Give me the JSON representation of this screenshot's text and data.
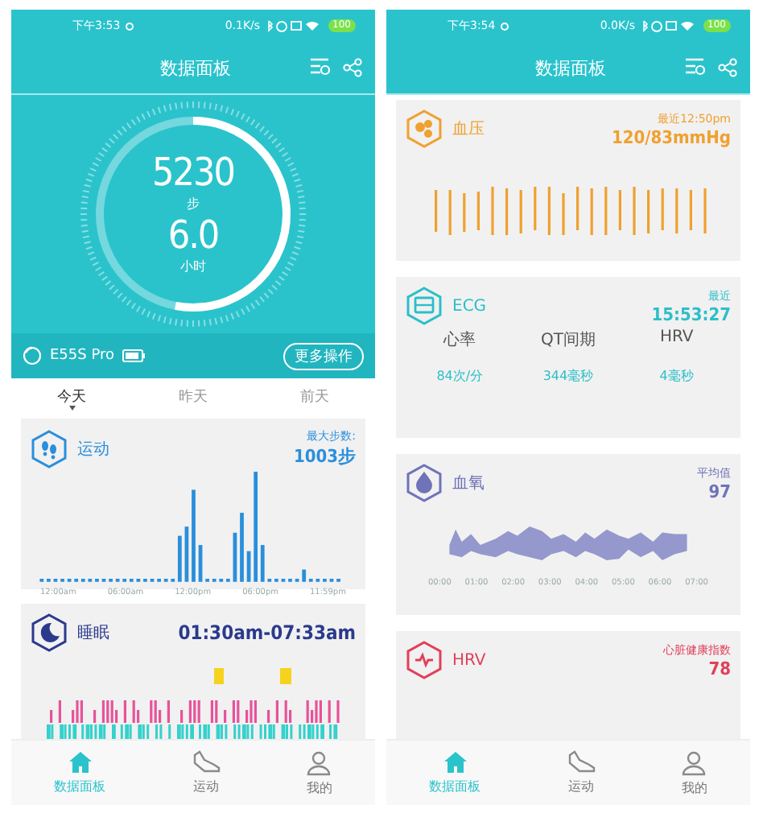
{
  "phones": [
    {
      "status": {
        "time": "下午3:53",
        "speed": "0.1K/s",
        "battery": "100"
      },
      "title": "数据面板",
      "summary": {
        "steps": "5230",
        "steps_unit": "步",
        "hours": "6.0",
        "hours_unit": "小时",
        "level": 0.53,
        "device": "E55S Pro",
        "more_button": "更多操作"
      },
      "day_tabs": [
        {
          "label": "今天",
          "selected": true
        },
        {
          "label": "昨天",
          "selected": false
        },
        {
          "label": "前天",
          "selected": false
        }
      ],
      "cards": [
        {
          "kind": "steps",
          "title": "运动",
          "color": "#2a8fdb",
          "note": "最大步数:",
          "value": "1003步",
          "axis_labels": [
            "12:00am",
            "06:00am",
            "12:00pm",
            "06:00pm",
            "11:59pm"
          ]
        },
        {
          "kind": "sleep",
          "title": "睡眠",
          "color": "#2b3a8c",
          "value": "01:30am-07:33am"
        }
      ],
      "nav": [
        {
          "label": "数据面板",
          "selected": true
        },
        {
          "label": "运动",
          "selected": false
        },
        {
          "label": "我的",
          "selected": false
        }
      ]
    },
    {
      "status": {
        "time": "下午3:54",
        "speed": "0.0K/s",
        "battery": "100"
      },
      "title": "数据面板",
      "cards": [
        {
          "kind": "pressure",
          "title": "血压",
          "color": "#f0a030",
          "note": "最近12:50pm",
          "value": "120/83mmHg"
        },
        {
          "kind": "ecg",
          "title": "ECG",
          "color": "#2bbfc9",
          "note": "最近",
          "value": "15:53:27",
          "stats": [
            {
              "label": "心率",
              "value": "84次/分"
            },
            {
              "label": "QT间期",
              "value": "344毫秒"
            },
            {
              "label": "HRV",
              "value": "4毫秒"
            }
          ]
        },
        {
          "kind": "oxygen",
          "title": "血氧",
          "color": "#6f73b8",
          "note": "平均值",
          "value": "97",
          "axis_labels": [
            "00:00",
            "01:00",
            "02:00",
            "03:00",
            "04:00",
            "05:00",
            "06:00",
            "07:00"
          ]
        },
        {
          "kind": "hrv",
          "title": "HRV",
          "color": "#e0405a",
          "note": "心脏健康指数",
          "value": "78"
        }
      ],
      "nav": [
        {
          "label": "数据面板",
          "selected": true
        },
        {
          "label": "运动",
          "selected": false
        },
        {
          "label": "我的",
          "selected": false
        }
      ]
    }
  ]
}
